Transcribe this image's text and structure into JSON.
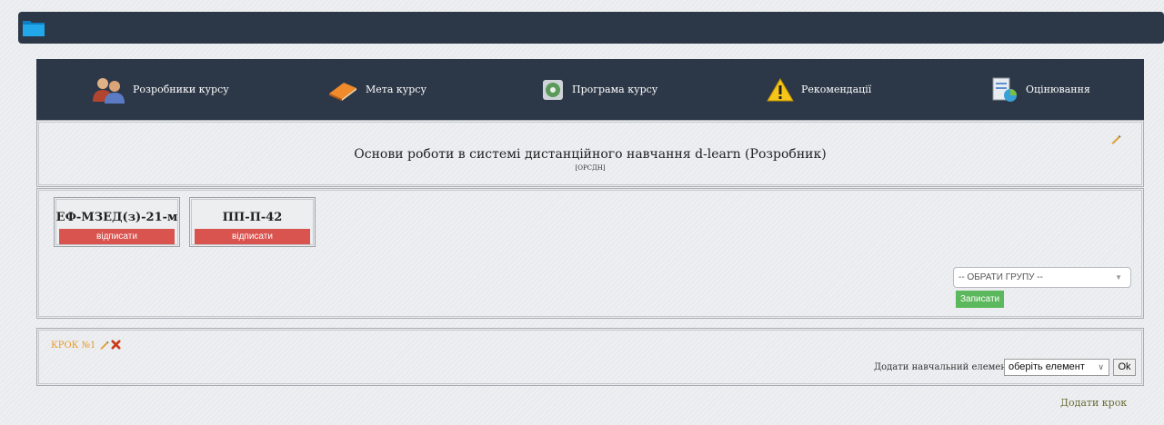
{
  "topbar": {
    "icon": "folder-icon"
  },
  "nav": [
    {
      "label": "Розробники курсу",
      "icon": "people-icon"
    },
    {
      "label": "Мета курсу",
      "icon": "book-icon"
    },
    {
      "label": "Програма курсу",
      "icon": "disc-icon"
    },
    {
      "label": "Рекомендації",
      "icon": "warning-icon"
    },
    {
      "label": "Оцінювання",
      "icon": "chart-icon"
    }
  ],
  "course": {
    "title": "Основи роботи в системі дистанційного навчання d-learn (Розробник)",
    "code": "[ОРСДН]"
  },
  "groups": [
    {
      "name": "ЕФ-МЗЕД(з)-21-м",
      "action": "відписати"
    },
    {
      "name": "ПП-П-42",
      "action": "відписати"
    }
  ],
  "group_select": {
    "placeholder": "-- ОБРАТИ ГРУПУ --",
    "enroll_label": "Записати"
  },
  "step": {
    "label": "КРОК №1",
    "add_element_label": "Додати навчальний елемент:",
    "element_select_value": "оберіть елемент",
    "ok_label": "Ok"
  },
  "add_step_label": "Додати крок",
  "colors": {
    "navbar": "#2c3747",
    "danger": "#d9534f",
    "success": "#5cb85c",
    "step": "#e89a2e"
  }
}
